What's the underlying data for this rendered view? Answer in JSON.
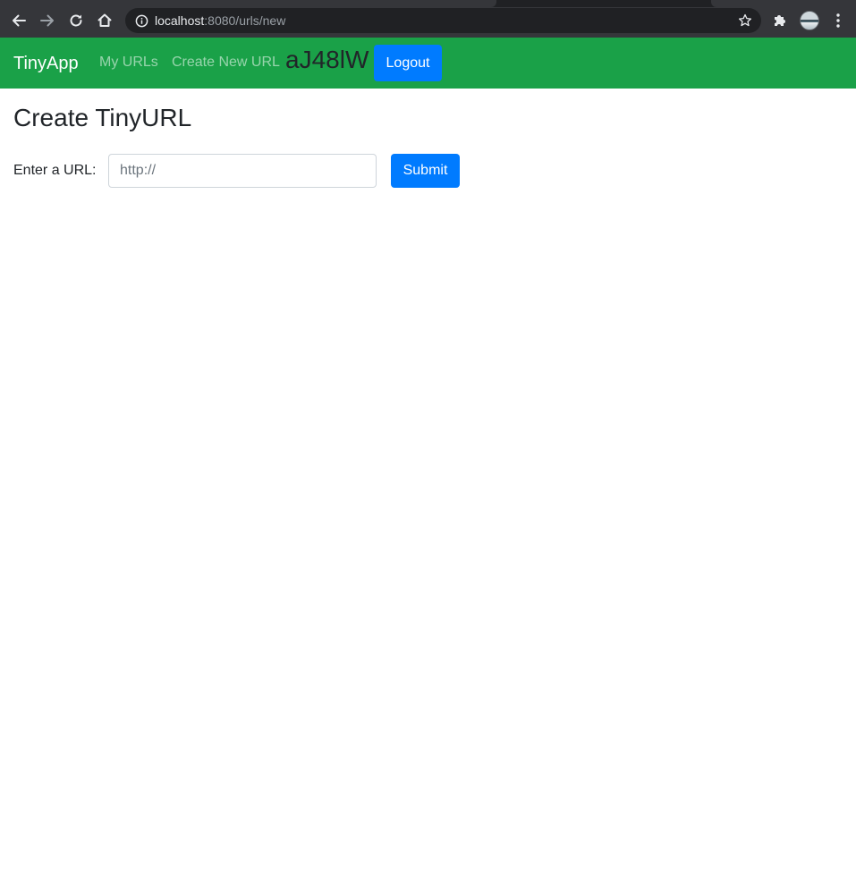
{
  "browser": {
    "url_host": "localhost",
    "url_rest": ":8080/urls/new",
    "icons": {
      "back": "arrow-left-icon",
      "forward": "arrow-right-icon",
      "reload": "reload-icon",
      "home": "home-icon",
      "site_info": "info-icon",
      "bookmark": "star-icon",
      "extensions": "puzzle-icon",
      "profile": "avatar",
      "menu": "kebab-menu-icon"
    }
  },
  "navbar": {
    "brand": "TinyApp",
    "links": [
      "My URLs",
      "Create New URL"
    ],
    "user_id": "aJ48lW",
    "logout_label": "Logout",
    "background_color": "#1aa148"
  },
  "main": {
    "title": "Create TinyURL",
    "form": {
      "label": "Enter a URL:",
      "placeholder": "http://",
      "value": "",
      "submit_label": "Submit"
    }
  },
  "colors": {
    "primary_button": "#007bff",
    "text": "#212529"
  }
}
